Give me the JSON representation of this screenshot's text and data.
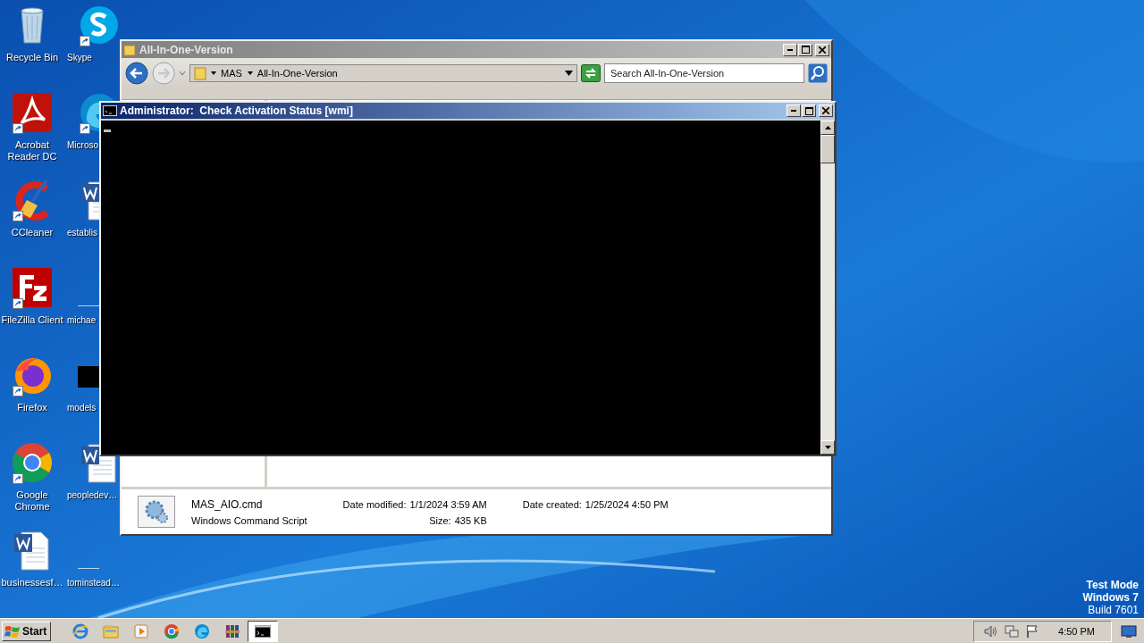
{
  "desktop": {
    "icons": [
      {
        "label": "Recycle Bin",
        "kind": "recycle",
        "shortcut": false
      },
      {
        "label": "Acrobat Reader DC",
        "kind": "acrobat",
        "shortcut": true
      },
      {
        "label": "CCleaner",
        "kind": "ccleaner",
        "shortcut": true
      },
      {
        "label": "FileZilla Client",
        "kind": "filezilla",
        "shortcut": true
      },
      {
        "label": "Firefox",
        "kind": "firefox",
        "shortcut": true
      },
      {
        "label": "Google Chrome",
        "kind": "chrome",
        "shortcut": true
      },
      {
        "label": "businessesf…",
        "kind": "word",
        "shortcut": false
      },
      {
        "label": "Skype",
        "kind": "skype",
        "shortcut": true
      },
      {
        "label": "Microso",
        "kind": "edge",
        "shortcut": true
      },
      {
        "label": "establis",
        "kind": "word",
        "shortcut": false
      },
      {
        "label": "michae",
        "kind": "blank",
        "shortcut": false
      },
      {
        "label": "models",
        "kind": "black",
        "shortcut": false
      },
      {
        "label": "peopledev…",
        "kind": "word",
        "shortcut": false
      },
      {
        "label": "tominstead…",
        "kind": "blank",
        "shortcut": false
      }
    ],
    "system_text": [
      "Test Mode",
      "Windows 7",
      "Build 7601"
    ]
  },
  "explorer": {
    "title": "All-In-One-Version",
    "active": false,
    "breadcrumbs": [
      "MAS",
      "All-In-One-Version"
    ],
    "search": {
      "placeholder": "Search All-In-One-Version"
    },
    "details": {
      "name": "MAS_AIO.cmd",
      "type": "Windows Command Script",
      "fields": [
        {
          "label": "Date modified:",
          "value": "1/1/2024 3:59 AM"
        },
        {
          "label": "Date created:",
          "value": "1/25/2024 4:50 PM"
        },
        {
          "label": "Size:",
          "value": "435 KB"
        }
      ]
    }
  },
  "console": {
    "title": "Administrator:  Check Activation Status [wmi]",
    "active": true
  },
  "taskbar": {
    "start": "Start",
    "apps": [
      {
        "kind": "ie",
        "active": false
      },
      {
        "kind": "explorer",
        "active": false
      },
      {
        "kind": "media",
        "active": false
      },
      {
        "kind": "chrome",
        "active": false
      },
      {
        "kind": "edge",
        "active": false
      },
      {
        "kind": "winrar",
        "active": false
      },
      {
        "kind": "cmd",
        "active": true
      }
    ],
    "clock": "4:50 PM"
  }
}
